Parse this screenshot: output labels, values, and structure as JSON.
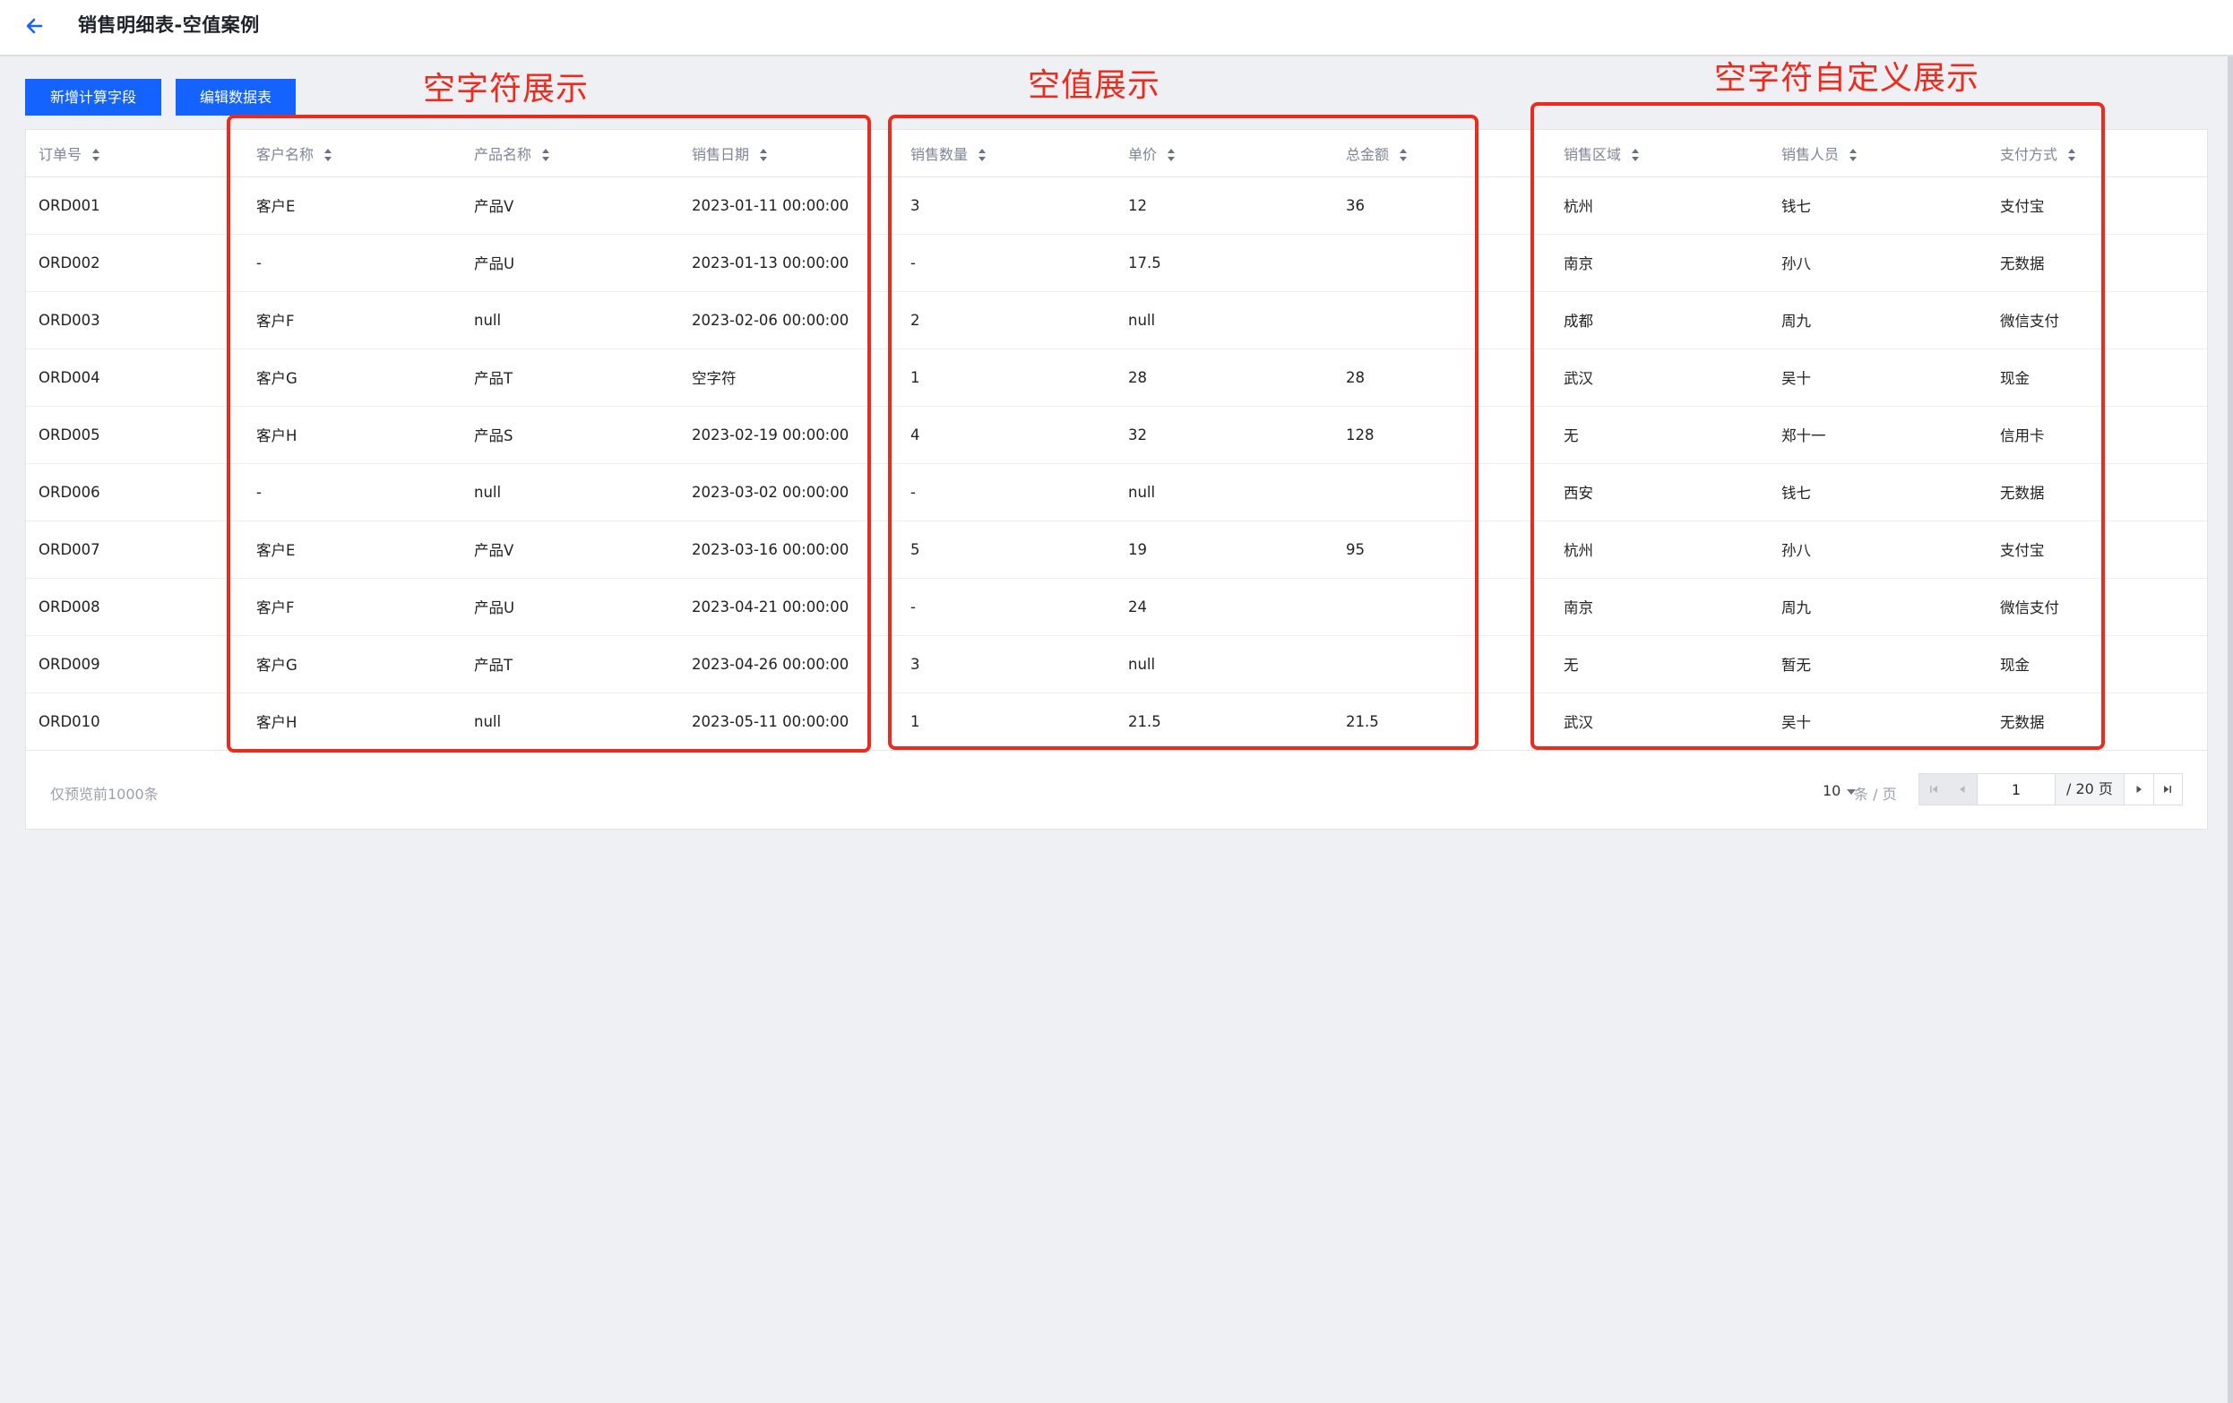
{
  "header": {
    "title": "销售明细表-空值案例",
    "back_icon": "arrow-left-icon"
  },
  "toolbar": {
    "add_calc_field": "新增计算字段",
    "edit_table": "编辑数据表"
  },
  "table": {
    "columns": [
      "订单号",
      "客户名称",
      "产品名称",
      "销售日期",
      "销售数量",
      "单价",
      "总金额",
      "销售区域",
      "销售人员",
      "支付方式"
    ],
    "rows": [
      [
        "ORD001",
        "客户E",
        "产品V",
        "2023-01-11 00:00:00",
        "3",
        "12",
        "36",
        "杭州",
        "钱七",
        "支付宝"
      ],
      [
        "ORD002",
        "-",
        "产品U",
        "2023-01-13 00:00:00",
        "-",
        "17.5",
        "",
        "南京",
        "孙八",
        "无数据"
      ],
      [
        "ORD003",
        "客户F",
        "null",
        "2023-02-06 00:00:00",
        "2",
        "null",
        "",
        "成都",
        "周九",
        "微信支付"
      ],
      [
        "ORD004",
        "客户G",
        "产品T",
        "空字符",
        "1",
        "28",
        "28",
        "武汉",
        "吴十",
        "现金"
      ],
      [
        "ORD005",
        "客户H",
        "产品S",
        "2023-02-19 00:00:00",
        "4",
        "32",
        "128",
        "无",
        "郑十一",
        "信用卡"
      ],
      [
        "ORD006",
        "-",
        "null",
        "2023-03-02 00:00:00",
        "-",
        "null",
        "",
        "西安",
        "钱七",
        "无数据"
      ],
      [
        "ORD007",
        "客户E",
        "产品V",
        "2023-03-16 00:00:00",
        "5",
        "19",
        "95",
        "杭州",
        "孙八",
        "支付宝"
      ],
      [
        "ORD008",
        "客户F",
        "产品U",
        "2023-04-21 00:00:00",
        "-",
        "24",
        "",
        "南京",
        "周九",
        "微信支付"
      ],
      [
        "ORD009",
        "客户G",
        "产品T",
        "2023-04-26 00:00:00",
        "3",
        "null",
        "",
        "无",
        "暂无",
        "现金"
      ],
      [
        "ORD010",
        "客户H",
        "null",
        "2023-05-11 00:00:00",
        "1",
        "21.5",
        "21.5",
        "武汉",
        "吴十",
        "无数据"
      ]
    ]
  },
  "footer": {
    "preview_note": "仅预览前1000条",
    "page_size": "10",
    "per_page_label": "条 / 页",
    "current_page": "1",
    "total_pages": "/ 20 页"
  },
  "annotations": {
    "empty_string_display": "空字符展示",
    "null_value_display": "空值展示",
    "custom_empty_string_display": "空字符自定义展示",
    "color": "#ee2a1c"
  },
  "colors": {
    "accent": "#1563ff",
    "page_bg": "#eff0f4"
  }
}
